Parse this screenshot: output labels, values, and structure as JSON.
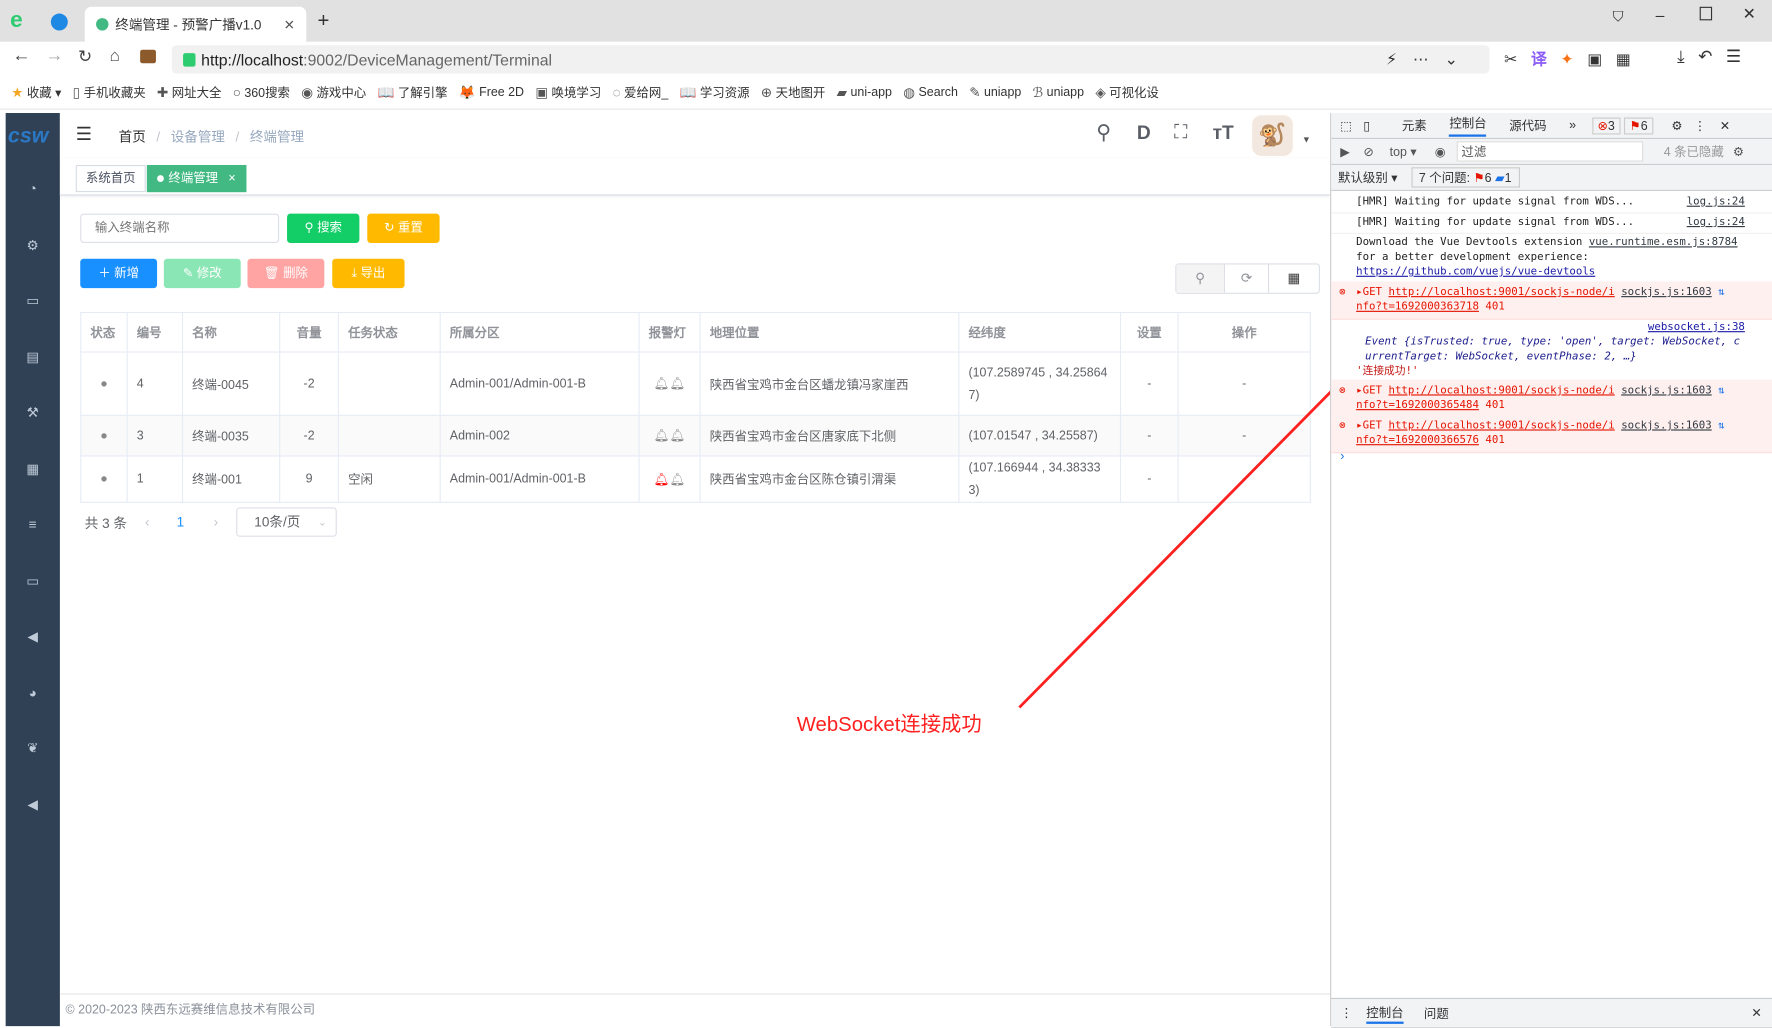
{
  "browser": {
    "tab_title": "终端管理 - 预警广播v1.0",
    "url_host": "http://localhost",
    "url_rest": ":9002/DeviceManagement/Terminal",
    "bookmarks": [
      "收藏",
      "手机收藏夹",
      "网址大全",
      "360搜索",
      "游戏中心",
      "了解引擎",
      "Free 2D",
      "唤境学习",
      "爱给网_",
      "学习资源",
      "天地图开",
      "uni-app",
      "Search",
      "uniapp",
      "uniapp",
      "可视化设"
    ]
  },
  "navbar": {
    "breadcrumb": [
      "首页",
      "设备管理",
      "终端管理"
    ]
  },
  "tags": {
    "home": "系统首页",
    "active": "终端管理",
    "close": "×"
  },
  "search": {
    "placeholder": "输入终端名称",
    "search_label": "搜索",
    "reset_label": "重置"
  },
  "toolbar": {
    "add": "新增",
    "edit": "修改",
    "delete": "删除",
    "export": "导出"
  },
  "table": {
    "headers": [
      "状态",
      "编号",
      "名称",
      "音量",
      "任务状态",
      "所属分区",
      "报警灯",
      "地理位置",
      "经纬度",
      "设置",
      "操作"
    ],
    "rows": [
      {
        "id": "4",
        "name": "终端-0045",
        "volume": "-2",
        "task": "",
        "zone": "Admin-001/Admin-001-B",
        "alarm_on": false,
        "location": "陕西省宝鸡市金台区蟠龙镇冯家崖西",
        "coords": "(107.2589745 , 34.258647)",
        "setting": "-",
        "action": "-"
      },
      {
        "id": "3",
        "name": "终端-0035",
        "volume": "-2",
        "task": "",
        "zone": "Admin-002",
        "alarm_on": false,
        "location": "陕西省宝鸡市金台区唐家底下北侧",
        "coords": "(107.01547 , 34.25587)",
        "setting": "-",
        "action": "-"
      },
      {
        "id": "1",
        "name": "终端-001",
        "volume": "9",
        "task": "空闲",
        "zone": "Admin-001/Admin-001-B",
        "alarm_on": true,
        "location": "陕西省宝鸡市金台区陈仓镇引渭渠",
        "coords": "(107.166944 , 34.383333)",
        "setting": "-",
        "action": "-"
      }
    ]
  },
  "pagination": {
    "total": "共 3 条",
    "page": "1",
    "page_size": "10条/页"
  },
  "footer": "© 2020-2023 陕西东远赛维信息技术有限公司",
  "annotation": "WebSocket连接成功",
  "devtools": {
    "tabs": [
      "元素",
      "控制台",
      "源代码"
    ],
    "errors": "3",
    "issues_badge": "6",
    "context": "top",
    "filter": "过滤",
    "hidden": "4 条已隐藏",
    "level": "默认级别",
    "issues": "7 个问题:",
    "issues_err": "6",
    "issues_info": "1",
    "logs": [
      {
        "text": "[HMR] Waiting for update signal from WDS...",
        "src": "log.js:24"
      },
      {
        "text": "[HMR] Waiting for update signal from WDS...",
        "src": "log.js:24"
      },
      {
        "text": "Download the Vue Devtools extension",
        "text2": "for a better development experience:",
        "link": "https://github.com/vuejs/vue-devtools",
        "src": "vue.runtime.esm.js:8784"
      }
    ],
    "err1": {
      "method": "GET",
      "url": "http://localhost:9001/sockjs-node/i",
      "url2": "nfo?t=1692000363718",
      "code": "401",
      "src": "sockjs.js:1603"
    },
    "event": {
      "src": "websocket.js:38",
      "line1": "Event {isTrusted: true, type: 'open', target: WebSocket, c",
      "line2": "urrentTarget: WebSocket, eventPhase: 2, …}",
      "msg": "'连接成功!'"
    },
    "err2": {
      "method": "GET",
      "url": "http://localhost:9001/sockjs-node/i",
      "url2": "nfo?t=1692000365484",
      "code": "401",
      "src": "sockjs.js:1603"
    },
    "err3": {
      "method": "GET",
      "url": "http://localhost:9001/sockjs-node/i",
      "url2": "nfo?t=1692000366576",
      "code": "401",
      "src": "sockjs.js:1603"
    },
    "drawer_tabs": [
      "控制台",
      "问题"
    ]
  },
  "colors": {
    "sidebar": "#304156",
    "primary": "#1890ff",
    "success": "#13ce66",
    "warning": "#ffba00",
    "tag_active": "#42b983",
    "annotation": "#ff2020"
  }
}
